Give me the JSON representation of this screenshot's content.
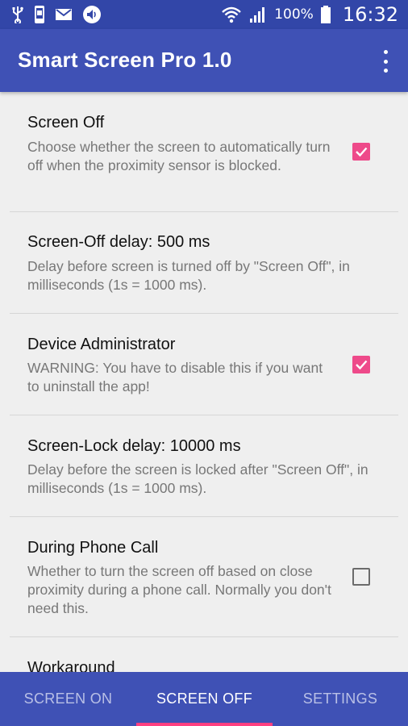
{
  "status_bar": {
    "icons_left": [
      "usb-icon",
      "phone-icon",
      "gmail-icon",
      "volume-icon"
    ],
    "icons_right": [
      "wifi-icon",
      "signal-icon",
      "battery-icon"
    ],
    "battery": "100%",
    "time": "16:32"
  },
  "app_bar": {
    "title": "Smart Screen Pro 1.0",
    "overflow_icon": "more-vert-icon"
  },
  "preferences": [
    {
      "title": "Screen Off",
      "summary": "Choose whether the screen to automatically turn off when the proximity sensor is blocked.",
      "checkbox": true
    },
    {
      "title": "Screen-Off delay: 500 ms",
      "summary": "Delay before screen is turned off by \"Screen Off\", in milliseconds (1s = 1000 ms)."
    },
    {
      "title": "Device Administrator",
      "summary": "WARNING: You have to disable this if you want to uninstall the app!",
      "checkbox": true
    },
    {
      "title": "Screen-Lock delay: 10000 ms",
      "summary": "Delay before the screen is locked after \"Screen Off\", in milliseconds (1s = 1000 ms)."
    },
    {
      "title": "During Phone Call",
      "summary": "Whether to turn the screen off based on close proximity during a phone call. Normally you don't need this.",
      "checkbox": false
    },
    {
      "title": "Workaround"
    }
  ],
  "tabs": [
    {
      "label": "SCREEN ON",
      "active": false
    },
    {
      "label": "SCREEN OFF",
      "active": true
    },
    {
      "label": "SETTINGS",
      "active": false
    }
  ],
  "colors": {
    "status_bar": "#3246a8",
    "primary": "#3f51b5",
    "accent": "#ff4081",
    "checkbox_checked": "#ee4a8a",
    "background": "#efefef"
  }
}
